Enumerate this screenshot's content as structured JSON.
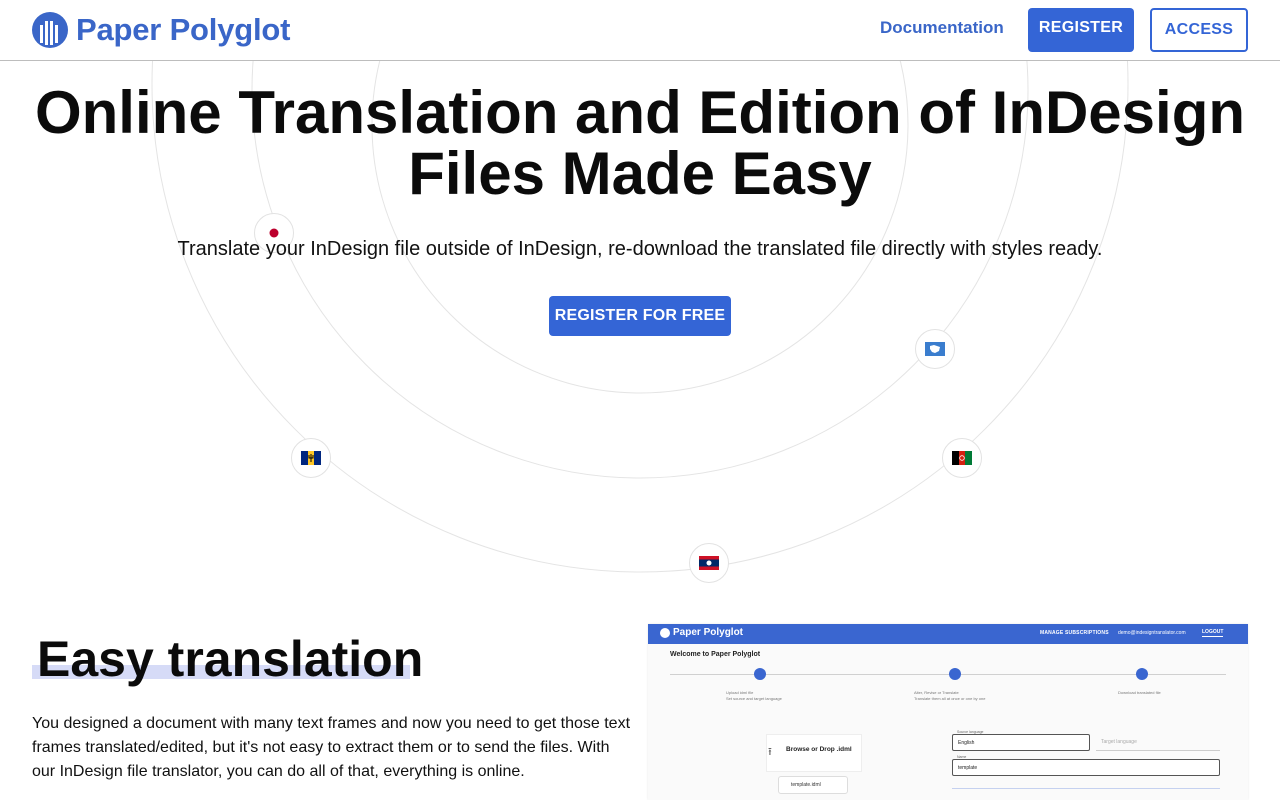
{
  "header": {
    "brand": "Paper Polyglot",
    "nav_documentation": "Documentation",
    "register_label": "REGISTER",
    "access_label": "ACCESS",
    "logo_icon": "paper-polyglot-logo-icon"
  },
  "hero": {
    "title": "Online Translation and Edition of InDesign Files Made Easy",
    "subtitle": "Translate your InDesign file outside of InDesign, re-download the translated file directly with styles ready.",
    "cta_label": "REGISTER FOR FREE",
    "flags": [
      "japan-flag-icon",
      "antarctica-flag-icon",
      "barbados-flag-icon",
      "afghanistan-flag-icon",
      "laos-flag-icon"
    ]
  },
  "feature": {
    "title": "Easy translation",
    "body": "You designed a document with many text frames and now you need to get those text frames translated/edited, but it's not easy to extract them or to send the files. With our InDesign file translator, you can do all of that, everything is online."
  },
  "mock_app": {
    "brand": "Paper Polyglot",
    "nav_manage": "MANAGE SUBSCRIPTIONS",
    "nav_email": "demo@indesigntranslator.com",
    "nav_logout": "LOGOUT",
    "welcome": "Welcome to Paper Polyglot",
    "steps": [
      {
        "label": "Upload idml file\nSet source and target language"
      },
      {
        "label": "Alter, Revise or Translate\nTranslate them all at once or one by one"
      },
      {
        "label": "Download translated file"
      }
    ],
    "drop_label": "Browse or Drop .idml",
    "file_name": "template.idml",
    "source_label": "Source language",
    "source_value": "English",
    "target_placeholder": "Target language",
    "name_label": "Name",
    "name_value": "template"
  },
  "colors": {
    "brand_blue": "#3465d6",
    "highlight": "#d6dbf7"
  }
}
